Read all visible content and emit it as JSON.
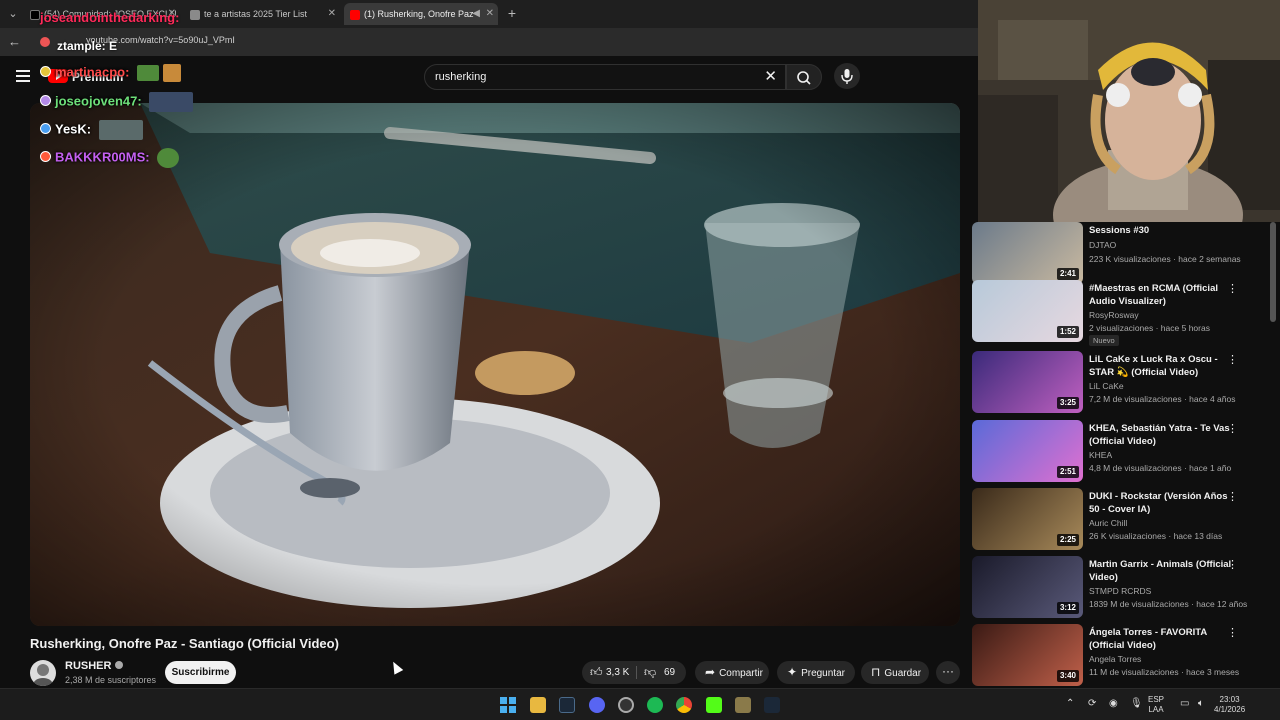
{
  "browser": {
    "tabs": [
      {
        "label": "(54) Comunidad: JOSEO EXCLU"
      },
      {
        "label": "te a artistas 2025 Tier List"
      },
      {
        "label": "(1) Rusherking, Onofre Paz"
      }
    ],
    "url": "youtube.com/watch?v=5o90uJ_VPmI"
  },
  "stream_overlay": {
    "tag_top": "joseandointhedarking:",
    "tag_url": "ztample: E"
  },
  "chat": [
    {
      "user": "martinacpo:",
      "color": "#ff4a4a",
      "dot": "#e6c43a"
    },
    {
      "user": "joseojoven47:",
      "color": "#6ee07a",
      "dot": "#b48ae8"
    },
    {
      "user": "YesK:",
      "color": "#ffffff",
      "dot": "#4a9ef0"
    },
    {
      "user": "BAKKKR00MS:",
      "color": "#c460f0",
      "dot": "#ff5a3a"
    }
  ],
  "yt": {
    "premium_label": "Premium",
    "search_value": "rusherking"
  },
  "video": {
    "title": "Rusherking, Onofre Paz - Santiago (Official Video)",
    "channel": "RUSHER",
    "subscribers": "2,38 M de suscriptores",
    "subscribe_label": "Suscribirme",
    "likes": "3,3 K",
    "dislikes": "69",
    "share_label": "Compartir",
    "ask_label": "Preguntar",
    "save_label": "Guardar"
  },
  "suggestions": [
    {
      "title": "Sessions #30",
      "channel": "DJTAO",
      "meta": "223 K visualizaciones · hace 2 semanas",
      "duration": "2:41",
      "badge": "",
      "c1": "#6b7a8a",
      "c2": "#c9b9a0"
    },
    {
      "title": "#Maestras en RCMA (Official Audio Visualizer)",
      "channel": "RosyRosway",
      "meta": "2 visualizaciones · hace 5 horas",
      "duration": "1:52",
      "badge": "Nuevo",
      "c1": "#b7c9d9",
      "c2": "#e7d8e0"
    },
    {
      "title": "LiL CaKe x Luck Ra x Oscu - STAR 💫 (Official Video)",
      "channel": "LiL CaKe",
      "meta": "7,2 M de visualizaciones · hace 4 años",
      "duration": "3:25",
      "badge": "",
      "c1": "#3a2a7a",
      "c2": "#c060c0"
    },
    {
      "title": "KHEA, Sebastián Yatra - Te Vas (Official Video)",
      "channel": "KHEA",
      "meta": "4,8 M de visualizaciones · hace 1 año",
      "duration": "2:51",
      "badge": "",
      "c1": "#5a6ad8",
      "c2": "#e070d0"
    },
    {
      "title": "DUKI - Rockstar (Versión Años 50 - Cover IA)",
      "channel": "Auric Chill",
      "meta": "26 K visualizaciones · hace 13 días",
      "duration": "2:25",
      "badge": "",
      "c1": "#3a2a1a",
      "c2": "#a88a5a"
    },
    {
      "title": "Martin Garrix - Animals (Official Video)",
      "channel": "STMPD RCRDS",
      "meta": "1839 M de visualizaciones · hace 12 años",
      "duration": "3:12",
      "badge": "",
      "c1": "#1a1a2a",
      "c2": "#5a5a7a"
    },
    {
      "title": "Ángela Torres - FAVORITA (Official Video)",
      "channel": "Angela Torres",
      "meta": "11 M de visualizaciones · hace 3 meses",
      "duration": "3:40",
      "badge": "",
      "c1": "#3a1a14",
      "c2": "#c0604a"
    }
  ],
  "taskbar": {
    "lang_line1": "ESP",
    "lang_line2": "LAA",
    "time": "23:03",
    "date": "4/1/2026"
  },
  "colors": {
    "accent_red": "#ff0000",
    "background": "#0f0f0f",
    "pill": "#272727"
  }
}
